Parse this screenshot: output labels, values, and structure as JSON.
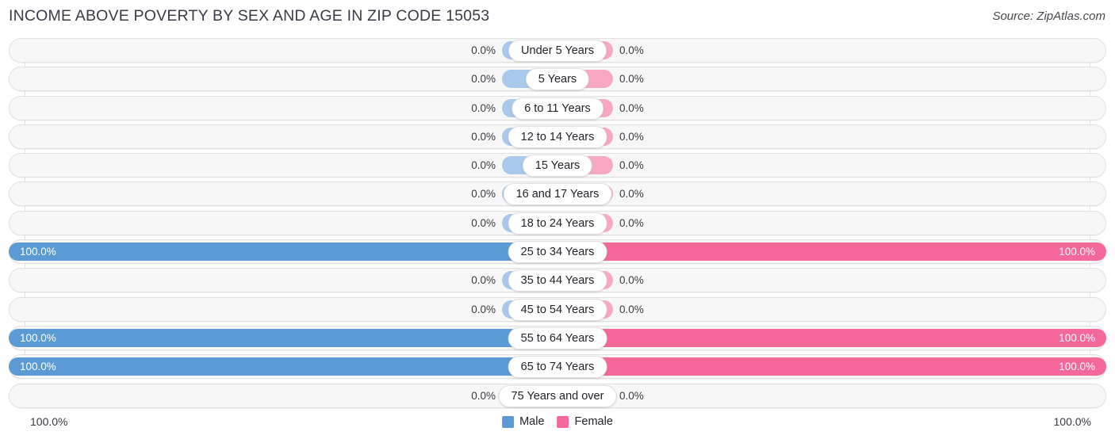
{
  "header": {
    "title": "INCOME ABOVE POVERTY BY SEX AND AGE IN ZIP CODE 15053",
    "source": "Source: ZipAtlas.com"
  },
  "footer": {
    "axis_left": "100.0%",
    "axis_right": "100.0%",
    "legend": [
      {
        "label": "Male",
        "color": "#5b9bd5"
      },
      {
        "label": "Female",
        "color": "#f4699a"
      }
    ]
  },
  "colors": {
    "male_full": "#5b9bd5",
    "male_zero": "#a8c8ec",
    "female_full": "#f4699a",
    "female_zero": "#f9a8c4",
    "track": "#f7f7f7",
    "track_border": "#e1e1e1",
    "gridline": "#e4e4e4"
  },
  "chart_data": {
    "type": "bar",
    "title": "INCOME ABOVE POVERTY BY SEX AND AGE IN ZIP CODE 15053",
    "subtitle": "",
    "xlabel": "",
    "ylabel": "",
    "orientation": "horizontal-diverging",
    "grid": true,
    "legend_position": "bottom-center",
    "xlim": [
      0,
      100
    ],
    "axis_ticks": [
      "100.0%",
      "100.0%"
    ],
    "categories": [
      "Under 5 Years",
      "5 Years",
      "6 to 11 Years",
      "12 to 14 Years",
      "15 Years",
      "16 and 17 Years",
      "18 to 24 Years",
      "25 to 34 Years",
      "35 to 44 Years",
      "45 to 54 Years",
      "55 to 64 Years",
      "65 to 74 Years",
      "75 Years and over"
    ],
    "series": [
      {
        "name": "Male",
        "color": "#5b9bd5",
        "values": [
          0.0,
          0.0,
          0.0,
          0.0,
          0.0,
          0.0,
          0.0,
          100.0,
          0.0,
          0.0,
          100.0,
          100.0,
          0.0
        ],
        "labels": [
          "0.0%",
          "0.0%",
          "0.0%",
          "0.0%",
          "0.0%",
          "0.0%",
          "0.0%",
          "100.0%",
          "0.0%",
          "0.0%",
          "100.0%",
          "100.0%",
          "0.0%"
        ]
      },
      {
        "name": "Female",
        "color": "#f4699a",
        "values": [
          0.0,
          0.0,
          0.0,
          0.0,
          0.0,
          0.0,
          0.0,
          100.0,
          0.0,
          0.0,
          100.0,
          100.0,
          0.0
        ],
        "labels": [
          "0.0%",
          "0.0%",
          "0.0%",
          "0.0%",
          "0.0%",
          "0.0%",
          "0.0%",
          "100.0%",
          "0.0%",
          "0.0%",
          "100.0%",
          "100.0%",
          "0.0%"
        ]
      }
    ]
  }
}
